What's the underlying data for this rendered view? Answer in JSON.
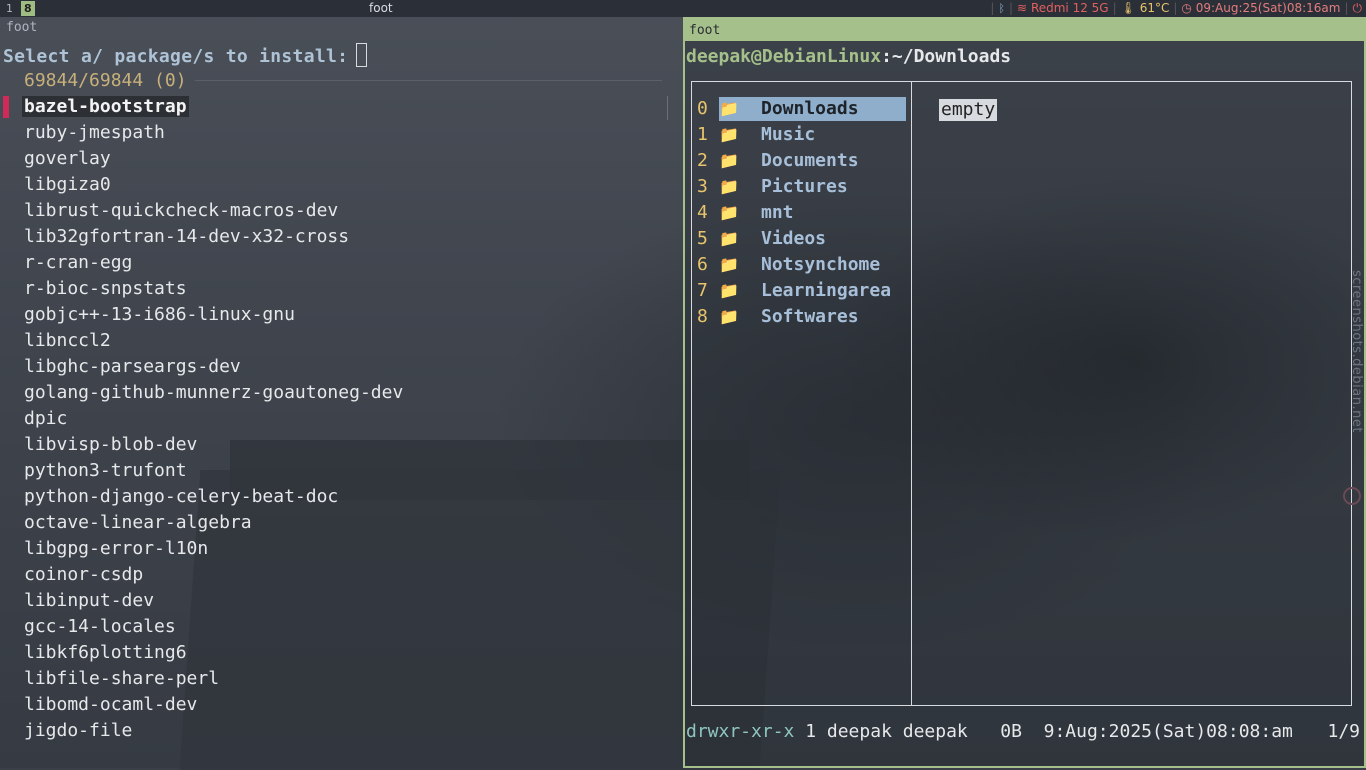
{
  "topbar": {
    "workspaces": [
      "1",
      "8"
    ],
    "active_workspace": "8",
    "window_title": "foot",
    "bluetooth_icon": "bluetooth-icon",
    "wifi_label": "Redmi 12 5G",
    "temp_label": "61°C",
    "clock_label": "09:Aug:25(Sat)08:16am",
    "power_icon": "power-icon"
  },
  "left_terminal": {
    "title": "foot",
    "prompt": "Select a/ package/s to install:",
    "counter": "69844/69844 (0)",
    "packages": [
      "bazel-bootstrap",
      "ruby-jmespath",
      "goverlay",
      "libgiza0",
      "librust-quickcheck-macros-dev",
      "lib32gfortran-14-dev-x32-cross",
      "r-cran-egg",
      "r-bioc-snpstats",
      "gobjc++-13-i686-linux-gnu",
      "libnccl2",
      "libghc-parseargs-dev",
      "golang-github-munnerz-goautoneg-dev",
      "dpic",
      "libvisp-blob-dev",
      "python3-trufont",
      "python-django-celery-beat-doc",
      "octave-linear-algebra",
      "libgpg-error-l10n",
      "coinor-csdp",
      "libinput-dev",
      "gcc-14-locales",
      "libkf6plotting6",
      "libfile-share-perl",
      "libomd-ocaml-dev",
      "jigdo-file"
    ],
    "selected_index": 0
  },
  "right_terminal": {
    "title": "foot",
    "user_host": "deepak@DebianLinux",
    "colon": ":",
    "path": "~/Downloads",
    "dirs": [
      {
        "num": "0",
        "name": "Downloads"
      },
      {
        "num": "1",
        "name": "Music"
      },
      {
        "num": "2",
        "name": "Documents"
      },
      {
        "num": "3",
        "name": "Pictures"
      },
      {
        "num": "4",
        "name": "mnt"
      },
      {
        "num": "5",
        "name": "Videos"
      },
      {
        "num": "6",
        "name": "Notsynchome"
      },
      {
        "num": "7",
        "name": "Learningarea"
      },
      {
        "num": "8",
        "name": "Softwares"
      }
    ],
    "active_dir": 0,
    "preview": "empty",
    "footer": {
      "perms": "drwxr-xr-x",
      "info": " 1 deepak deepak   0B  9:Aug:2025(Sat)08:08:am",
      "position": "1/9"
    }
  },
  "watermark": "screenshots.debian.net",
  "colors": {
    "accent_border": "#a5c08a",
    "selection_bar": "#d02a5a",
    "highlight": "#8faecb"
  }
}
